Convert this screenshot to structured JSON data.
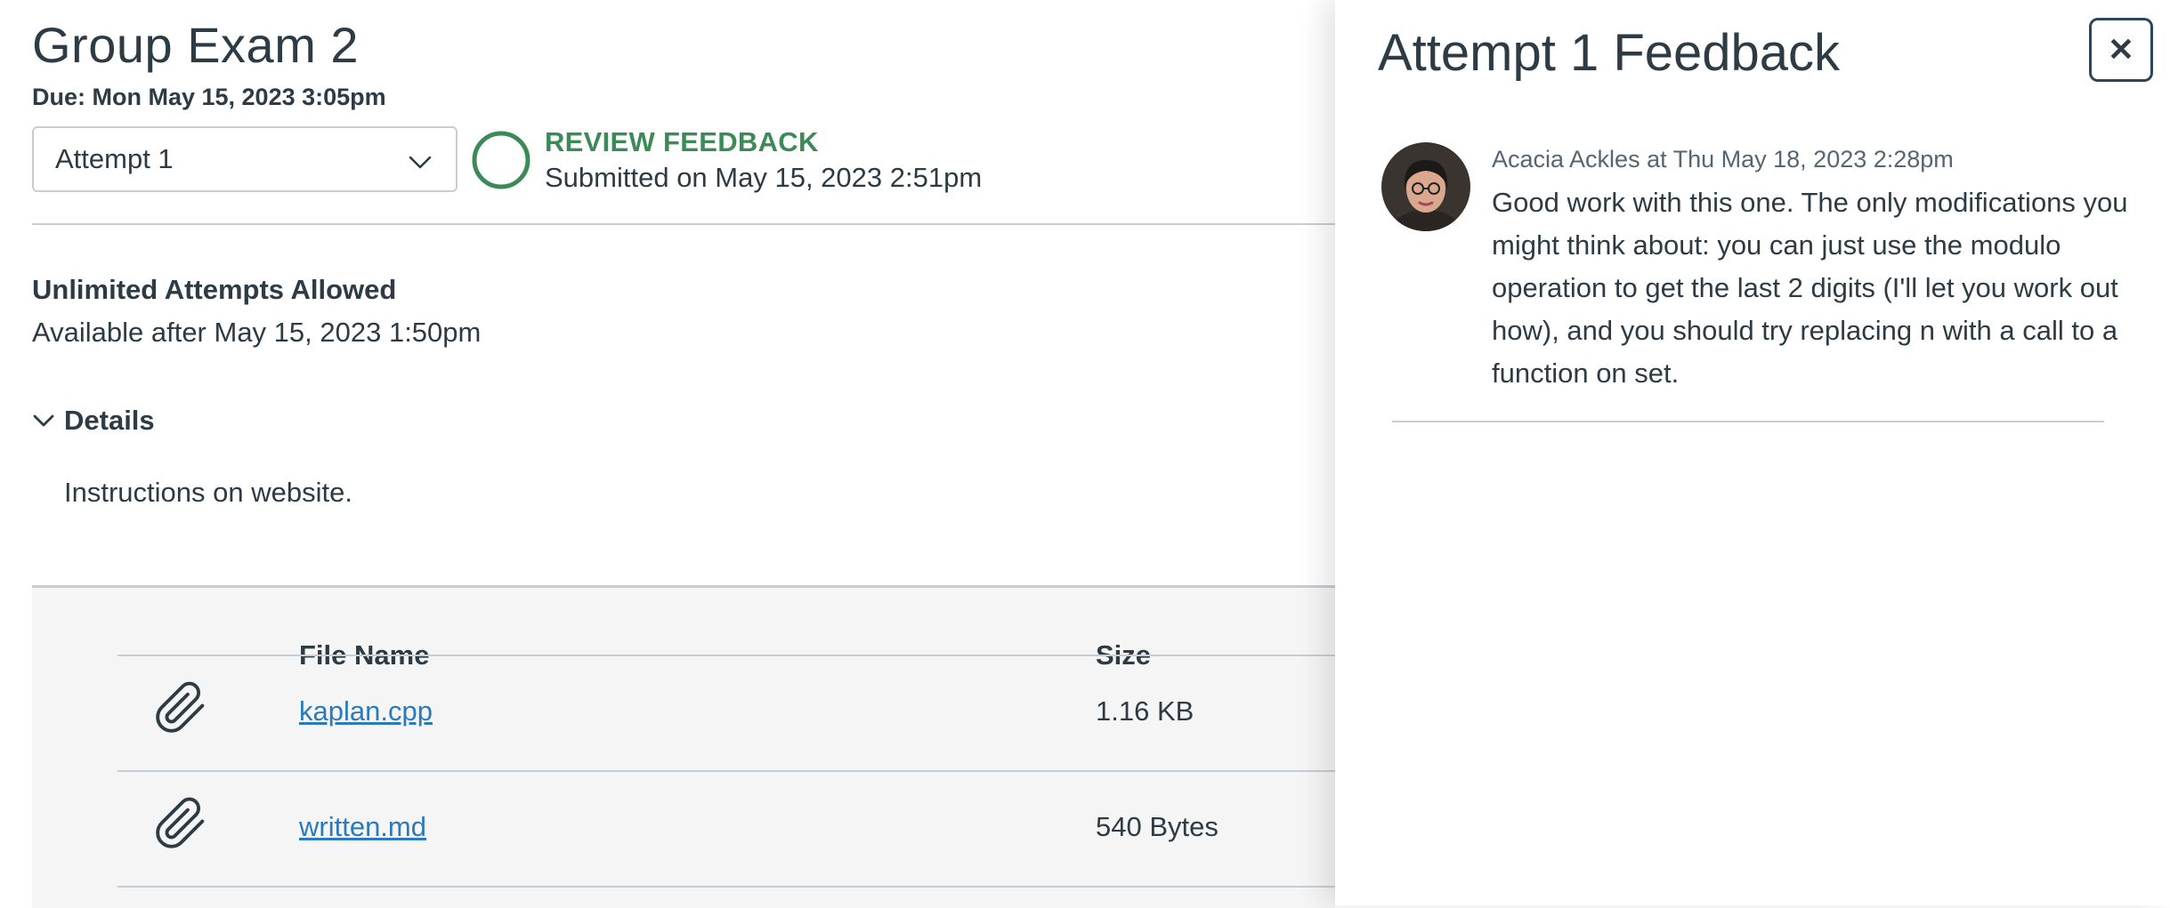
{
  "assignment": {
    "title": "Group Exam 2",
    "due": "Due: Mon May 15, 2023 3:05pm",
    "attempt_select": {
      "selected": "Attempt 1"
    },
    "status": {
      "label": "REVIEW FEEDBACK",
      "submitted": "Submitted on May 15, 2023 2:51pm",
      "color": "#3b8a57"
    },
    "attempts_allowed": "Unlimited Attempts Allowed",
    "available": "Available after May 15, 2023 1:50pm",
    "details_label": "Details",
    "instructions": "Instructions on website."
  },
  "files": {
    "columns": [
      "File Name",
      "Size"
    ],
    "rows": [
      {
        "name": "kaplan.cpp",
        "size": "1.16 KB",
        "icon": "paperclip-icon"
      },
      {
        "name": "written.md",
        "size": "540 Bytes",
        "icon": "paperclip-icon"
      }
    ]
  },
  "feedback_tray": {
    "title": "Attempt 1 Feedback",
    "close_icon": "close-icon",
    "comments": [
      {
        "author_meta": "Acacia Ackles at Thu May 18, 2023 2:28pm",
        "body": "Good work with this one. The only modifications you might think about: you can just use the modulo operation to get the last 2 digits (I'll let you work out how), and you should try replacing n with a call to a function on set."
      }
    ]
  },
  "colors": {
    "text": "#2d3b45",
    "link": "#2b7abc",
    "success": "#3b8a57",
    "border": "#c7cdd1",
    "table_bg": "#f5f5f5"
  }
}
